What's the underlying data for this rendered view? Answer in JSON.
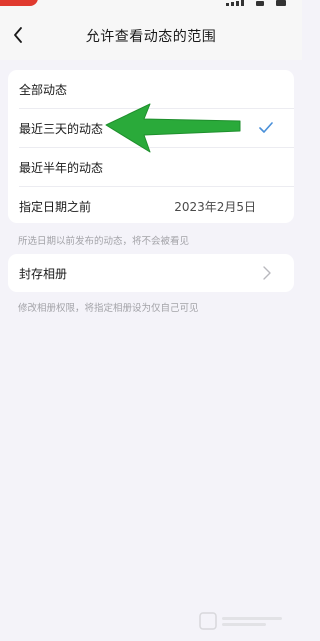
{
  "nav": {
    "title": "允许查看动态的范围"
  },
  "options": [
    {
      "label": "全部动态",
      "selected": false
    },
    {
      "label": "最近三天的动态",
      "selected": true
    },
    {
      "label": "最近半年的动态",
      "selected": false
    }
  ],
  "date_row": {
    "label": "指定日期之前",
    "value": "2023年2月5日"
  },
  "hint_visibility": "所选日期以前发布的动态，将不会被看见",
  "album": {
    "label": "封存相册"
  },
  "hint_album": "修改相册权限，将指定相册设为仅自己可见",
  "icons": {
    "back": "chevron-left-icon",
    "check": "check-icon",
    "chevron": "chevron-right-icon",
    "annotation": "green-arrow-icon"
  },
  "colors": {
    "background": "#f4f3f9",
    "card": "#ffffff",
    "accent_check": "#4a90d9",
    "arrow_green": "#2aaa3a",
    "hint_text": "#a3a3a8"
  }
}
